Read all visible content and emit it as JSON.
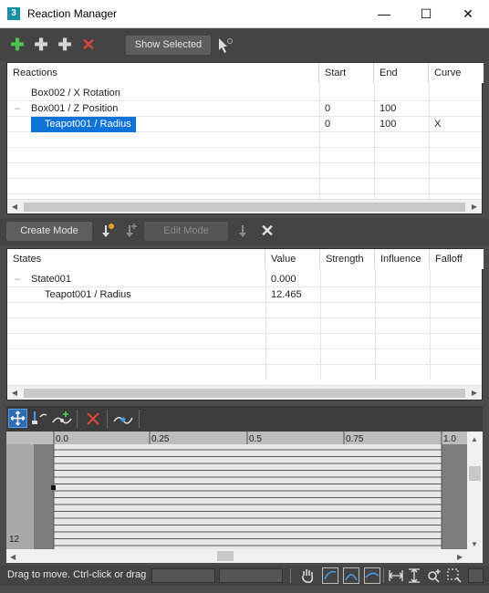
{
  "window": {
    "app_icon_text": "3",
    "title": "Reaction Manager",
    "minimize": "—",
    "maximize": "☐",
    "close": "✕"
  },
  "toolbar": {
    "show_selected_label": "Show Selected"
  },
  "reactions_table": {
    "headers": [
      "Reactions",
      "Start",
      "End",
      "Curve"
    ],
    "rows": [
      {
        "name": "Box002 / X Rotation",
        "start": "",
        "end": "",
        "curve": ""
      },
      {
        "name": "Box001 / Z Position",
        "start": "0",
        "end": "100",
        "curve": ""
      },
      {
        "name": "Teapot001 / Radius",
        "start": "0",
        "end": "100",
        "curve": "X"
      }
    ]
  },
  "mode_bar": {
    "create_mode_label": "Create Mode",
    "edit_mode_label": "Edit Mode"
  },
  "states_table": {
    "headers": [
      "States",
      "Value",
      "Strength",
      "Influence",
      "Falloff"
    ],
    "rows": [
      {
        "name": "State001",
        "value": "0.000"
      },
      {
        "name": "Teapot001 / Radius",
        "value": "12.465"
      }
    ]
  },
  "curve_editor": {
    "ruler_labels": [
      "0.0",
      "0.25",
      "0.5",
      "0.75",
      "1.0"
    ],
    "left_value": "12"
  },
  "status": {
    "message": "Drag to move. Ctrl-click or drag"
  },
  "colors": {
    "selection": "#0f73d8",
    "add_green": "#4ec14e",
    "delete_red": "#d9463c"
  }
}
